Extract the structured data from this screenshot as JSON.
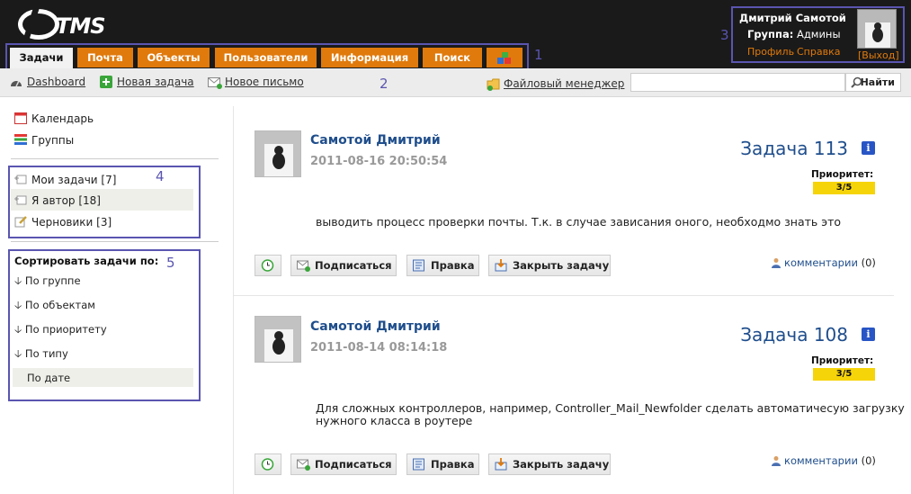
{
  "app": {
    "logo_text": "TMS"
  },
  "nav": {
    "tabs": [
      {
        "label": "Задачи",
        "active": true
      },
      {
        "label": "Почта"
      },
      {
        "label": "Объекты"
      },
      {
        "label": "Пользователи"
      },
      {
        "label": "Информация"
      },
      {
        "label": "Поиск"
      }
    ],
    "apps_icon": "apps-blocks-icon"
  },
  "annotations": {
    "n1": "1",
    "n2": "2",
    "n3": "3",
    "n4": "4",
    "n5": "5"
  },
  "user": {
    "name": "Дмитрий Самотой",
    "group_label": "Группа:",
    "group_value": "Админы",
    "profile_link": "Профиль",
    "help_link": "Справка",
    "logout_link": "[Выход]"
  },
  "toolbar": {
    "dashboard": "Dashboard",
    "new_task": "Новая задача",
    "new_letter": "Новое письмо",
    "file_manager": "Файловый менеджер",
    "search_placeholder": "",
    "search_button": "Найти"
  },
  "sidebar": {
    "calendar": "Календарь",
    "groups": "Группы",
    "my_tasks": "Мои задачи [7]",
    "i_author": "Я автор [18]",
    "drafts": "Черновики [3]",
    "sort_title": "Сортировать задачи по:",
    "sort_items": [
      "По группе",
      "По объектам",
      "По приоритету",
      "По типу",
      "По дате"
    ]
  },
  "tasks": [
    {
      "author": "Самотой Дмитрий",
      "date": "2011-08-16 20:50:54",
      "title": "Задача 113",
      "priority_label": "Приоритет:",
      "priority": "3/5",
      "body": "выводить процесс проверки почты. Т.к. в случае зависания оного, необходмо знать это",
      "subscribe": "Подписаться",
      "edit": "Правка",
      "close": "Закрыть задачу",
      "comments_link": "комментарии",
      "comments_count": "(0)"
    },
    {
      "author": "Самотой Дмитрий",
      "date": "2011-08-14 08:14:18",
      "title": "Задача 108",
      "priority_label": "Приоритет:",
      "priority": "3/5",
      "body_line1": "Для сложных контроллеров, например, Controller_Mail_Newfolder сделать автоматичесую загрузку",
      "body_line2": "нужного класса в роутере",
      "subscribe": "Подписаться",
      "edit": "Правка",
      "close": "Закрыть задачу",
      "comments_link": "комментарии",
      "comments_count": "(0)"
    }
  ],
  "colors": {
    "accent": "#e07a0c",
    "link": "#1f4e8c",
    "annotation": "#5a55b0",
    "priority": "#f6d40a"
  }
}
